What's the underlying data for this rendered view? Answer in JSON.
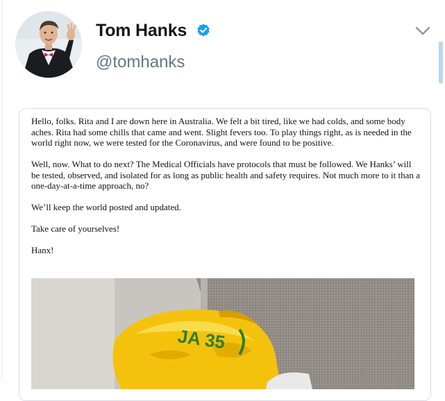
{
  "profile": {
    "display_name": "Tom Hanks",
    "handle": "@tomhanks",
    "verified_icon": "verified-badge-icon",
    "menu_icon": "chevron-down-icon"
  },
  "letter": {
    "paragraphs": [
      "Hello, folks. Rita and I are down here in Australia. We felt a bit tired, like we had colds, and some body aches. Rita had some chills that came and went. Slight fevers too. To play things right, as is needed in the world right now, we were tested for the Coronavirus, and were found to be positive.",
      "Well, now. What to do next? The Medical Officials have protocols that must be followed. We Hanks’ will be tested, observed, and isolated for as long as public health and safety requires.  Not much more to it than a one-day-at-a-time approach, no?",
      "We’ll keep the world posted and updated.",
      "Take care of yourselves!",
      "Hanx!"
    ]
  },
  "photo": {
    "bag_text": "JA 35"
  },
  "colors": {
    "text_primary": "#14171a",
    "text_secondary": "#657786",
    "verified_blue": "#1da1f2",
    "border": "#d8dde1"
  }
}
